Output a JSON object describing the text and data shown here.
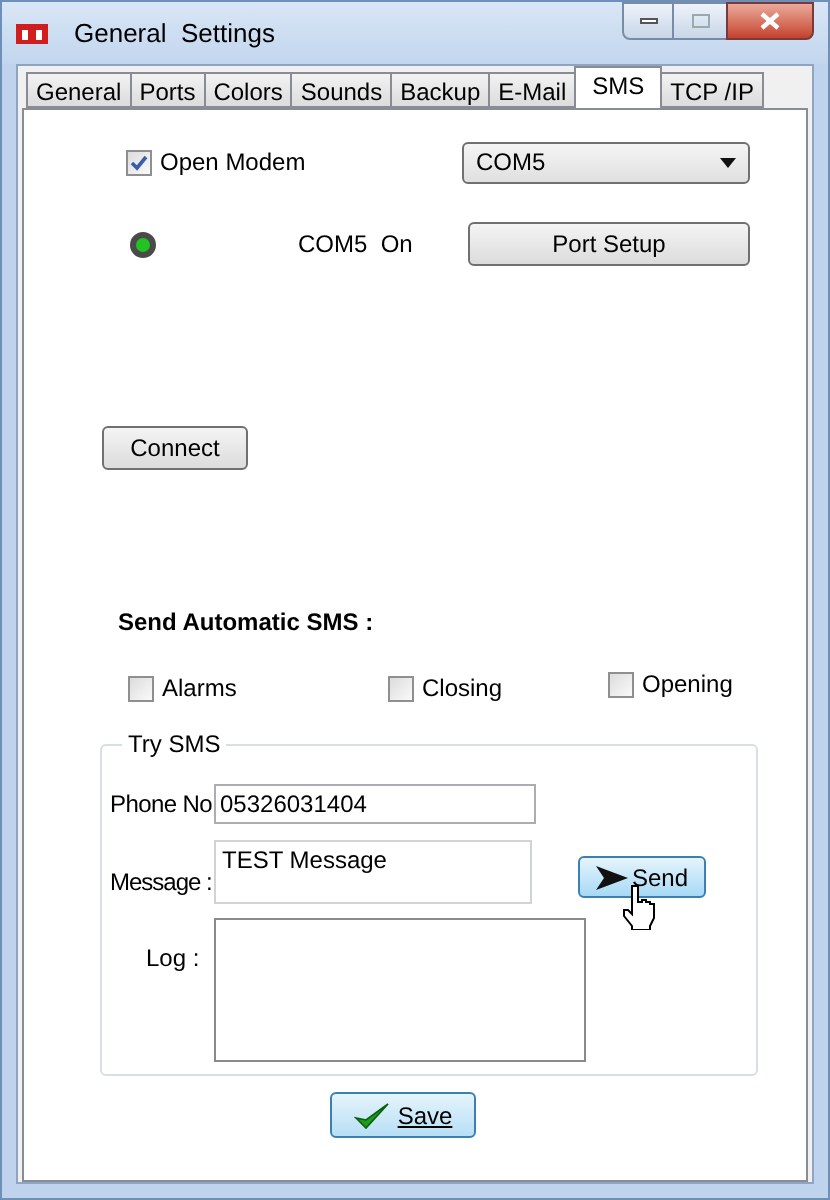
{
  "window": {
    "title": "General  Settings"
  },
  "tabs": [
    {
      "label": "General",
      "selected": false
    },
    {
      "label": "Ports",
      "selected": false
    },
    {
      "label": "Colors",
      "selected": false
    },
    {
      "label": "Sounds",
      "selected": false
    },
    {
      "label": "Backup",
      "selected": false
    },
    {
      "label": "E-Mail",
      "selected": false
    },
    {
      "label": "SMS",
      "selected": true
    },
    {
      "label": "TCP /IP",
      "selected": false
    }
  ],
  "modem": {
    "label": "Open Modem",
    "checked": true,
    "port": "COM5",
    "status": "COM5  On",
    "on": true,
    "port_setup": "Port Setup",
    "connect": "Connect"
  },
  "auto_sms": {
    "title": "Send Automatic SMS :",
    "options": [
      {
        "label": "Alarms",
        "checked": false
      },
      {
        "label": "Closing",
        "checked": false
      },
      {
        "label": "Opening",
        "checked": false
      }
    ]
  },
  "try_sms": {
    "legend": "Try SMS",
    "phone_label": "Phone No",
    "phone": "05326031404",
    "message_label": "Message :",
    "message": "TEST Message",
    "send": "Send",
    "log_label": "Log :"
  },
  "save": "Save"
}
